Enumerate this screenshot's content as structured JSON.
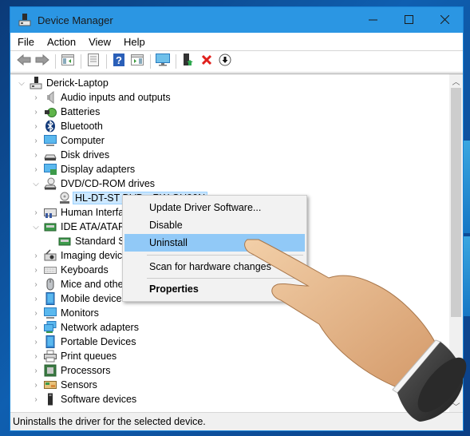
{
  "window": {
    "title": "Device Manager",
    "controls": {
      "minimize": "—",
      "maximize": "☐",
      "close": "✕"
    }
  },
  "menu": [
    "File",
    "Action",
    "View",
    "Help"
  ],
  "toolbar": [
    {
      "name": "back",
      "icon": "back-arrow-icon"
    },
    {
      "name": "forward",
      "icon": "forward-arrow-icon"
    },
    {
      "name": "show-hide-console-tree",
      "icon": "console-tree-icon"
    },
    {
      "name": "properties",
      "icon": "properties-icon"
    },
    {
      "name": "help",
      "icon": "help-icon"
    },
    {
      "name": "show-hide-action-pane",
      "icon": "action-pane-icon"
    },
    {
      "name": "scan-hardware",
      "icon": "monitor-scan-icon"
    },
    {
      "name": "update-driver",
      "icon": "update-driver-icon"
    },
    {
      "name": "uninstall",
      "icon": "red-x-icon"
    },
    {
      "name": "disable",
      "icon": "down-arrow-circle-icon"
    }
  ],
  "tree": {
    "root": "Derick-Laptop",
    "items": [
      {
        "label": "Audio inputs and outputs",
        "icon": "speaker-icon",
        "expanded": false
      },
      {
        "label": "Batteries",
        "icon": "battery-icon",
        "expanded": false
      },
      {
        "label": "Bluetooth",
        "icon": "bluetooth-icon",
        "expanded": false
      },
      {
        "label": "Computer",
        "icon": "computer-icon",
        "expanded": false
      },
      {
        "label": "Disk drives",
        "icon": "disk-drive-icon",
        "expanded": false
      },
      {
        "label": "Display adapters",
        "icon": "display-adapter-icon",
        "expanded": false
      },
      {
        "label": "DVD/CD-ROM drives",
        "icon": "dvd-drive-icon",
        "expanded": true,
        "children": [
          {
            "label": "HL-DT-ST DVD+-RW GU90N",
            "icon": "dvd-disc-icon",
            "selected": true
          }
        ]
      },
      {
        "label": "Human Interface Devices",
        "icon": "hid-icon",
        "expanded": false
      },
      {
        "label": "IDE ATA/ATAPI controllers",
        "icon": "ide-controller-icon",
        "expanded": true,
        "children": [
          {
            "label": "Standard SATA AHCI Controller",
            "icon": "controller-icon"
          }
        ]
      },
      {
        "label": "Imaging devices",
        "icon": "camera-icon",
        "expanded": false
      },
      {
        "label": "Keyboards",
        "icon": "keyboard-icon",
        "expanded": false
      },
      {
        "label": "Mice and other pointing devices",
        "icon": "mouse-icon",
        "expanded": false
      },
      {
        "label": "Mobile devices",
        "icon": "mobile-device-icon",
        "expanded": false
      },
      {
        "label": "Monitors",
        "icon": "monitor-icon",
        "expanded": false
      },
      {
        "label": "Network adapters",
        "icon": "network-adapter-icon",
        "expanded": false
      },
      {
        "label": "Portable Devices",
        "icon": "portable-device-icon",
        "expanded": false
      },
      {
        "label": "Print queues",
        "icon": "printer-icon",
        "expanded": false
      },
      {
        "label": "Processors",
        "icon": "processor-icon",
        "expanded": false
      },
      {
        "label": "Sensors",
        "icon": "sensor-icon",
        "expanded": false
      },
      {
        "label": "Software devices",
        "icon": "software-device-icon",
        "expanded": false
      }
    ]
  },
  "context_menu": {
    "items": [
      {
        "label": "Update Driver Software...",
        "highlighted": false,
        "bold": false
      },
      {
        "label": "Disable",
        "highlighted": false,
        "bold": false
      },
      {
        "label": "Uninstall",
        "highlighted": true,
        "bold": false
      },
      {
        "label": "Scan for hardware changes",
        "highlighted": false,
        "bold": false
      },
      {
        "label": "Properties",
        "highlighted": false,
        "bold": true
      }
    ]
  },
  "status_bar": "Uninstalls the driver for the selected device.",
  "colors": {
    "titlebar": "#2b96e3",
    "selection": "#cce8ff",
    "menu_highlight": "#91c9f7"
  }
}
